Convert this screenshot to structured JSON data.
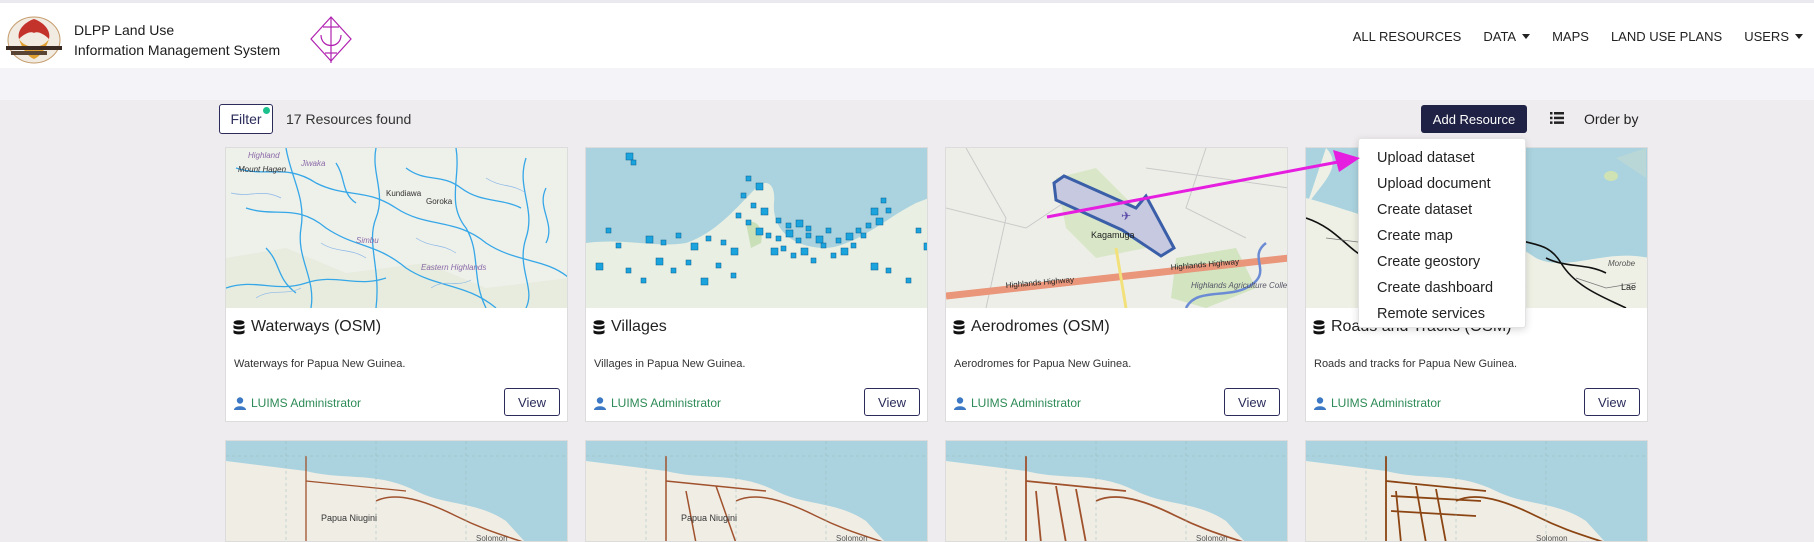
{
  "header": {
    "brand_line1": "DLPP Land Use",
    "brand_line2": "Information Management System",
    "nav": [
      {
        "label": "ALL RESOURCES"
      },
      {
        "label": "DATA"
      },
      {
        "label": "MAPS"
      },
      {
        "label": "LAND USE PLANS"
      },
      {
        "label": "USERS"
      }
    ]
  },
  "toolbar": {
    "filter_label": "Filter",
    "result_count": "17 Resources found",
    "add_resource_label": "Add Resource",
    "order_by_label": "Order by"
  },
  "add_menu": {
    "items": [
      "Upload dataset",
      "Upload document",
      "Create dataset",
      "Create map",
      "Create geostory",
      "Create dashboard",
      "Remote services"
    ]
  },
  "cards": [
    {
      "title": "Waterways (OSM)",
      "description": "Waterways for Papua New Guinea.",
      "owner": "LUIMS Administrator",
      "view_label": "View",
      "map_labels": [
        "Highland",
        "Mount Hagen",
        "Jiwaka",
        "Kundiawa",
        "Goroka",
        "Simbu",
        "Eastern Highlands"
      ]
    },
    {
      "title": "Villages",
      "description": "Villages in Papua New Guinea.",
      "owner": "LUIMS Administrator",
      "view_label": "View",
      "map_labels": []
    },
    {
      "title": "Aerodromes (OSM)",
      "description": "Aerodromes for Papua New Guinea.",
      "owner": "LUIMS Administrator",
      "view_label": "View",
      "map_labels": [
        "Kagamuga",
        "Highlands Highway",
        "Highlands Highway",
        "Highlands Agriculture College"
      ]
    },
    {
      "title": "Roads and Tracks (OSM)",
      "description": "Roads and tracks for Papua New Guinea.",
      "owner": "LUIMS Administrator",
      "view_label": "View",
      "map_labels": [
        "Morobe",
        "Lae"
      ]
    }
  ],
  "cards_row2": [
    {
      "map_labels": [
        "Papua Niugini",
        "Solomon"
      ]
    },
    {
      "map_labels": [
        "Papua Niugini",
        "Solomon"
      ]
    },
    {
      "map_labels": [
        "Solomon"
      ]
    },
    {
      "map_labels": [
        "Solomon"
      ]
    }
  ],
  "colors": {
    "accent": "#1f2244",
    "owner_green": "#2e8b57",
    "annotation_arrow": "#e51ee0",
    "water": "#aad3df",
    "village_marker": "#1aa3dd"
  }
}
